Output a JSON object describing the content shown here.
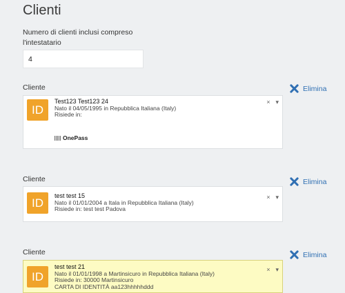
{
  "page": {
    "title": "Clienti"
  },
  "count": {
    "label": "Numero di clienti inclusi compreso l'intestatario",
    "value": "4"
  },
  "client_label": "Cliente",
  "delete_label": "Elimina",
  "id_badge": "ID",
  "controls": {
    "clear": "×",
    "expand": "▾"
  },
  "clients": [
    {
      "name": "Test123 Test123 24",
      "line1": "Nato il 04/05/1995 in Repubblica Italiana (Italy)",
      "line2": "Risiede in:",
      "onepass": "OnePass"
    },
    {
      "name": "test test 15",
      "line1": "Nato il 01/01/2004 a Itala in Repubblica Italiana (Italy)",
      "line2": "Risiede in: test test Padova"
    },
    {
      "name": "test test 21",
      "line1": "Nato il 01/01/1998 a Martinsicuro in Repubblica Italiana (Italy)",
      "line2": "Risiede in: 30000 Martinsicuro",
      "line3": "CARTA DI IDENTITÀ aa123hhhhhddd"
    }
  ],
  "colors": {
    "accent": "#2f6fb3",
    "id_badge": "#f0a32a",
    "highlight": "#fdfbc3"
  }
}
